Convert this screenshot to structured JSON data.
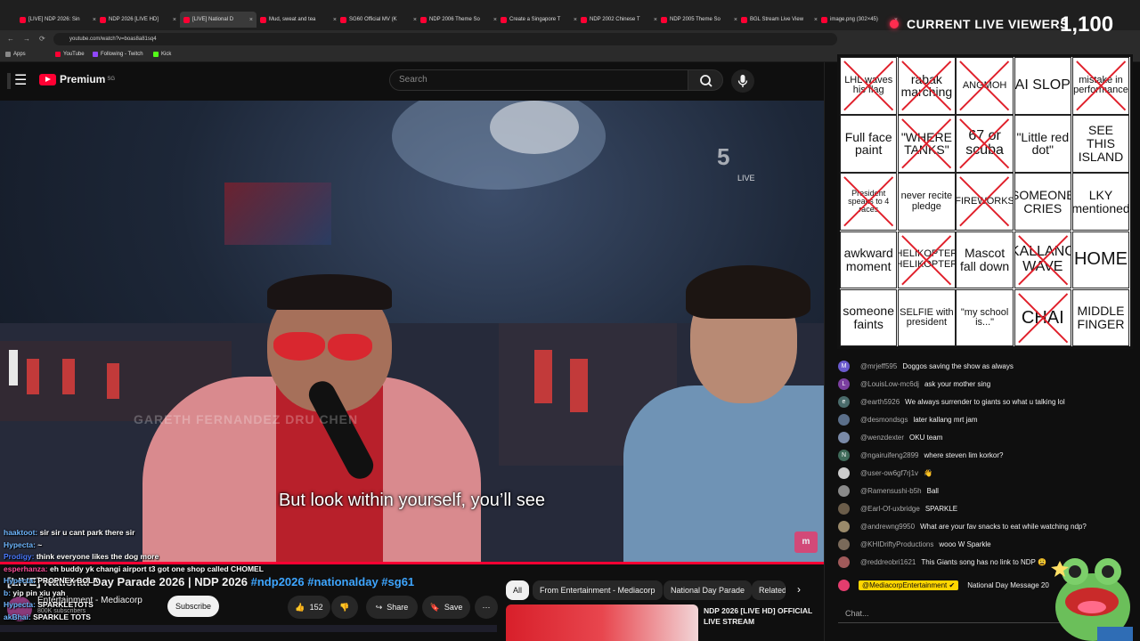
{
  "tabs": [
    {
      "label": "[LIVE] NDP 2026: Sin",
      "active": false
    },
    {
      "label": "NDP 2026 [LIVE HD]",
      "active": false
    },
    {
      "label": "[LIVE] National D",
      "active": true
    },
    {
      "label": "Mud, sweat and tea",
      "active": false
    },
    {
      "label": "SG60 Official MV (K",
      "active": false
    },
    {
      "label": "NDP 2006 Theme So",
      "active": false
    },
    {
      "label": "Create a Singapore T",
      "active": false
    },
    {
      "label": "NDP 2002 Chinese T",
      "active": false
    },
    {
      "label": "NDP 2005 Theme So",
      "active": false
    },
    {
      "label": "BGL Stream Live View",
      "active": false
    },
    {
      "label": "image.png (302×45)",
      "active": false
    }
  ],
  "address": "youtube.com/watch?v=boas8a81sq4",
  "bookmarks": [
    {
      "label": "Apps",
      "color": "#888888"
    },
    {
      "label": "YouTube",
      "color": "#ff0033"
    },
    {
      "label": "Following - Twitch",
      "color": "#9146ff"
    },
    {
      "label": "Kick",
      "color": "#53fc18"
    }
  ],
  "header": {
    "logo_text": "Premium",
    "logo_sup": "SG",
    "search_placeholder": "Search"
  },
  "video": {
    "channel_watermark": "5",
    "live_label": "LIVE",
    "name_watermark": "GARETH FERNANDEZ  DRU CHEN",
    "subtitle": "But look within yourself, you’ll see",
    "corner_logo": "m"
  },
  "below": {
    "title_main": "[LIVE] National Day Parade 2026 | NDP 2026 ",
    "title_tags": "#ndp2026 #nationalday #sg61",
    "channel": "Entertainment - Mediacorp",
    "subscribers": "800K subscribers",
    "subscribe": "Subscribe",
    "likes": "152",
    "share": "Share",
    "save": "Save"
  },
  "overlay_chat": [
    {
      "user": "haaktoot:",
      "text": " sir sir u cant park there sir",
      "color": "#6fb7ff"
    },
    {
      "user": "Hypecta:",
      "text": " ~",
      "color": "#6fb7ff"
    },
    {
      "user": "Prodigy:",
      "text": " think everyone likes the dog more",
      "color": "#4b7bff"
    },
    {
      "user": "esperhanza:",
      "text": " eh buddy yk changi airport t3 got one shop called CHOMEL",
      "color": "#ff4f9a"
    },
    {
      "user": "Hypecta:",
      "text": " PROPNEX BOLA",
      "color": "#6fb7ff"
    },
    {
      "user": "b:",
      "text": " yip pin xiu yah",
      "color": "#6fb7ff"
    },
    {
      "user": "Hypecta:",
      "text": " SPARKLETOTS",
      "color": "#6fb7ff"
    },
    {
      "user": "akBhai:",
      "text": " SPARKLE TOTS",
      "color": "#6fb7ff"
    }
  ],
  "chips": [
    "All",
    "From Entertainment - Mediacorp",
    "National Day Parade",
    "Related"
  ],
  "recommendation": {
    "title": "NDP 2026 [LIVE HD] OFFICIAL LIVE STREAM"
  },
  "viewers": {
    "label": "CURRENT LIVE VIEWERS",
    "count": "1,100"
  },
  "bingo": [
    {
      "text": "LHL waves his flag",
      "crossed": true
    },
    {
      "text": "rabak marching",
      "crossed": true
    },
    {
      "text": "ANGMOH",
      "crossed": true
    },
    {
      "text": "AI SLOP",
      "crossed": false
    },
    {
      "text": "mistake in performance",
      "crossed": true
    },
    {
      "text": "Full face paint",
      "crossed": false
    },
    {
      "text": "\"WHERE TANKS\"",
      "crossed": true
    },
    {
      "text": "67 or scuba",
      "crossed": true
    },
    {
      "text": "\"Little red dot\"",
      "crossed": false
    },
    {
      "text": "SEE THIS ISLAND",
      "crossed": false
    },
    {
      "text": "President speaks to 4 races",
      "crossed": true
    },
    {
      "text": "never recite pledge",
      "crossed": false
    },
    {
      "text": "FIREWORKS",
      "crossed": true
    },
    {
      "text": "SOMEONE CRIES",
      "crossed": false
    },
    {
      "text": "LKY mentioned",
      "crossed": false
    },
    {
      "text": "awkward moment",
      "crossed": false
    },
    {
      "text": "HELIKOPTER HELIKOPTER",
      "crossed": true
    },
    {
      "text": "Mascot fall down",
      "crossed": false
    },
    {
      "text": "KALLANG WAVE",
      "crossed": true
    },
    {
      "text": "HOME",
      "crossed": false
    },
    {
      "text": "someone faints",
      "crossed": false
    },
    {
      "text": "SELFIE with president",
      "crossed": false
    },
    {
      "text": "\"my school is...\"",
      "crossed": false
    },
    {
      "text": "CHAI",
      "crossed": true
    },
    {
      "text": "MIDDLE FINGER",
      "crossed": false
    }
  ],
  "chat": [
    {
      "user": "@mrjeff595",
      "msg": "Doggos saving the show as always",
      "avatar": "M",
      "color": "#6a5acd"
    },
    {
      "user": "@LouisLow-mc6dj",
      "msg": "ask your mother sing",
      "avatar": "L",
      "color": "#7b3fa0"
    },
    {
      "user": "@earth5926",
      "msg": "We always surrender to giants so what u talking lol",
      "avatar": "e",
      "color": "#4a6b6b"
    },
    {
      "user": "@desmondsgs",
      "msg": "later kallang mrt jam",
      "avatar": "",
      "color": "#5b6f8a"
    },
    {
      "user": "@wenzdexter",
      "msg": "OKU team",
      "avatar": "",
      "color": "#7a8aa8"
    },
    {
      "user": "@ngairuifeng2899",
      "msg": "where steven lim korkor?",
      "avatar": "N",
      "color": "#3f6b5a"
    },
    {
      "user": "@user-ow6gf7rj1v",
      "msg": "👋",
      "avatar": "",
      "color": "#cccccc"
    },
    {
      "user": "@Ramensushi-b5h",
      "msg": "Ball",
      "avatar": "",
      "color": "#8a8a8a"
    },
    {
      "user": "@Earl-Of-uxbridge",
      "msg": "SPARKLE",
      "avatar": "",
      "color": "#6b5d4a"
    },
    {
      "user": "@andrewng9950",
      "msg": "What are your fav snacks to eat while watching ndp?",
      "avatar": "",
      "color": "#9a8a6a"
    },
    {
      "user": "@KHIDriftyProductions",
      "msg": "wooo W Sparkle",
      "avatar": "",
      "color": "#7a6a5a"
    },
    {
      "user": "@reddreobri1621",
      "msg": "This Giants song has no link to NDP 😩",
      "avatar": "",
      "color": "#a05a5a"
    }
  ],
  "pinned": {
    "badge": "@MediacorpEntertainment ✔",
    "text": "National Day Message 20"
  },
  "chat_input_placeholder": "Chat...",
  "colors": {
    "accent": "#ff0033",
    "link": "#3ea6ff",
    "cross": "#e0202b"
  }
}
